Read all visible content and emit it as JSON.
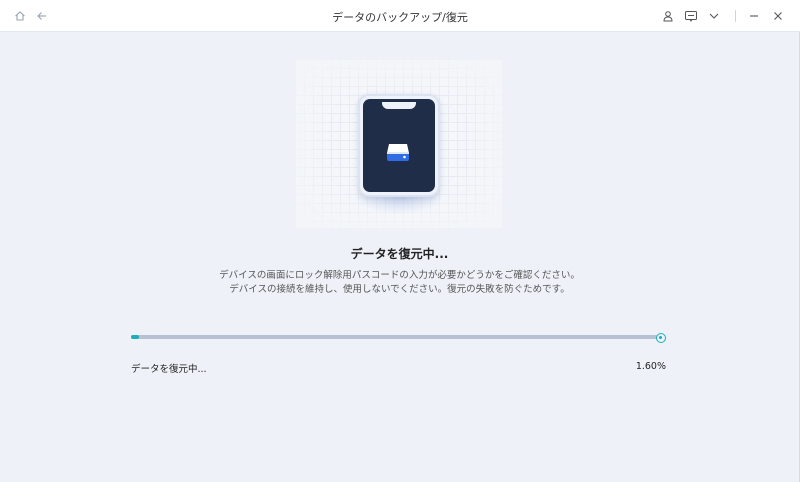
{
  "window": {
    "title": "データのバックアップ/復元"
  },
  "titlebar": {
    "left_icons": [
      "home-icon",
      "back-arrow-icon"
    ],
    "right_icons": [
      "user-icon",
      "feedback-icon",
      "chevron-down-icon",
      "minimize-icon",
      "close-icon"
    ]
  },
  "main": {
    "heading": "データを復元中...",
    "description_line1": "デバイスの画面にロック解除用パスコードの入力が必要かどうかをご確認ください。",
    "description_line2": "デバイスの接続を維持し、使用しないでください。復元の失敗を防ぐためです。"
  },
  "progress": {
    "label": "データを復元中...",
    "percent_text": "1.60%",
    "value": 0.016
  },
  "colors": {
    "accent": "#1ab0b8",
    "phone_screen": "#1f2d48",
    "drive_blue": "#2f6de0"
  }
}
